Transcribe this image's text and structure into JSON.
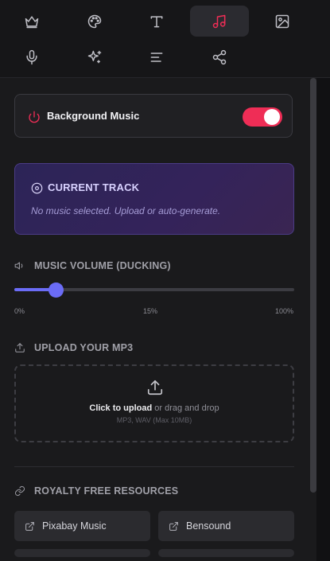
{
  "toolbar": {
    "icons": [
      "crown-icon",
      "palette-icon",
      "text-icon",
      "music-icon",
      "image-icon",
      "mic-icon",
      "sparkles-icon",
      "align-left-icon",
      "share-icon"
    ],
    "active": "music-icon",
    "accent": "#ef2d56"
  },
  "background_music": {
    "label": "Background Music",
    "enabled": true
  },
  "current_track": {
    "title": "CURRENT TRACK",
    "description": "No music selected. Upload or auto-generate."
  },
  "volume": {
    "heading": "MUSIC VOLUME (DUCKING)",
    "value_percent": 15,
    "tick_min": "0%",
    "tick_mid": "15%",
    "tick_max": "100%",
    "accent": "#6b6cf6"
  },
  "upload": {
    "heading": "UPLOAD YOUR MP3",
    "click_text": "Click to upload",
    "drag_text": " or drag and drop",
    "hint": "MP3, WAV (Max 10MB)"
  },
  "resources": {
    "heading": "ROYALTY FREE RESOURCES",
    "links": [
      {
        "label": "Pixabay Music"
      },
      {
        "label": "Bensound"
      }
    ]
  }
}
